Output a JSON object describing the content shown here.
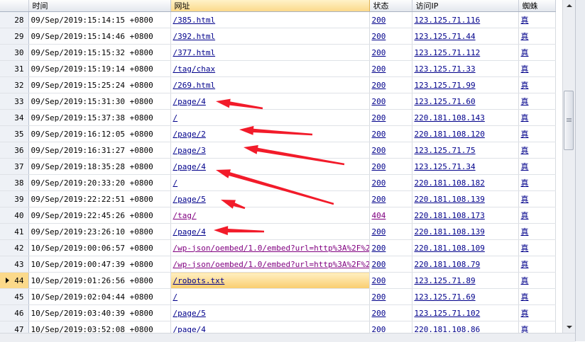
{
  "columns": {
    "num": "",
    "time": "时间",
    "url": "网址",
    "status": "状态",
    "ip": "访问IP",
    "spider": "蜘蛛"
  },
  "rows": [
    {
      "n": "28",
      "time": "09/Sep/2019:15:14:15 +0800",
      "url": "/385.html",
      "status": "200",
      "ip": "123.125.71.116",
      "spider": "真"
    },
    {
      "n": "29",
      "time": "09/Sep/2019:15:14:46 +0800",
      "url": "/392.html",
      "status": "200",
      "ip": "123.125.71.44",
      "spider": "真"
    },
    {
      "n": "30",
      "time": "09/Sep/2019:15:15:32 +0800",
      "url": "/377.html",
      "status": "200",
      "ip": "123.125.71.112",
      "spider": "真"
    },
    {
      "n": "31",
      "time": "09/Sep/2019:15:19:14 +0800",
      "url": "/tag/chax",
      "status": "200",
      "ip": "123.125.71.33",
      "spider": "真"
    },
    {
      "n": "32",
      "time": "09/Sep/2019:15:25:24 +0800",
      "url": "/269.html",
      "status": "200",
      "ip": "123.125.71.99",
      "spider": "真"
    },
    {
      "n": "33",
      "time": "09/Sep/2019:15:31:30 +0800",
      "url": "/page/4",
      "status": "200",
      "ip": "123.125.71.60",
      "spider": "真"
    },
    {
      "n": "34",
      "time": "09/Sep/2019:15:37:38 +0800",
      "url": "/",
      "status": "200",
      "ip": "220.181.108.143",
      "spider": "真"
    },
    {
      "n": "35",
      "time": "09/Sep/2019:16:12:05 +0800",
      "url": "/page/2",
      "status": "200",
      "ip": "220.181.108.120",
      "spider": "真"
    },
    {
      "n": "36",
      "time": "09/Sep/2019:16:31:27 +0800",
      "url": "/page/3",
      "status": "200",
      "ip": "123.125.71.75",
      "spider": "真"
    },
    {
      "n": "37",
      "time": "09/Sep/2019:18:35:28 +0800",
      "url": "/page/4",
      "status": "200",
      "ip": "123.125.71.34",
      "spider": "真"
    },
    {
      "n": "38",
      "time": "09/Sep/2019:20:33:20 +0800",
      "url": "/",
      "status": "200",
      "ip": "220.181.108.182",
      "spider": "真"
    },
    {
      "n": "39",
      "time": "09/Sep/2019:22:22:51 +0800",
      "url": "/page/5",
      "status": "200",
      "ip": "220.181.108.139",
      "spider": "真"
    },
    {
      "n": "40",
      "time": "09/Sep/2019:22:45:26 +0800",
      "url": "/tag/",
      "status": "404",
      "ip": "220.181.108.173",
      "spider": "真"
    },
    {
      "n": "41",
      "time": "09/Sep/2019:23:26:10 +0800",
      "url": "/page/4",
      "status": "200",
      "ip": "220.181.108.139",
      "spider": "真"
    },
    {
      "n": "42",
      "time": "10/Sep/2019:00:06:57 +0800",
      "url": "/wp-json/oembed/1.0/embed?url=http%3A%2F%2...",
      "status": "200",
      "ip": "220.181.108.109",
      "spider": "真"
    },
    {
      "n": "43",
      "time": "10/Sep/2019:00:47:39 +0800",
      "url": "/wp-json/oembed/1.0/embed?url=http%3A%2F%2...",
      "status": "200",
      "ip": "220.181.108.79",
      "spider": "真"
    },
    {
      "n": "44",
      "time": "10/Sep/2019:01:26:56 +0800",
      "url": "/robots.txt",
      "status": "200",
      "ip": "123.125.71.89",
      "spider": "真"
    },
    {
      "n": "45",
      "time": "10/Sep/2019:02:04:44 +0800",
      "url": "/",
      "status": "200",
      "ip": "123.125.71.69",
      "spider": "真"
    },
    {
      "n": "46",
      "time": "10/Sep/2019:03:40:39 +0800",
      "url": "/page/5",
      "status": "200",
      "ip": "123.125.71.102",
      "spider": "真"
    },
    {
      "n": "47",
      "time": "10/Sep/2019:03:52:08 +0800",
      "url": "/page/4",
      "status": "200",
      "ip": "220.181.108.86",
      "spider": "真"
    }
  ],
  "selected_row": "44",
  "colors": {
    "arrow": "#f21b2a",
    "link": "#00008b",
    "visited": "#800080",
    "selection": "#fbd98a"
  }
}
